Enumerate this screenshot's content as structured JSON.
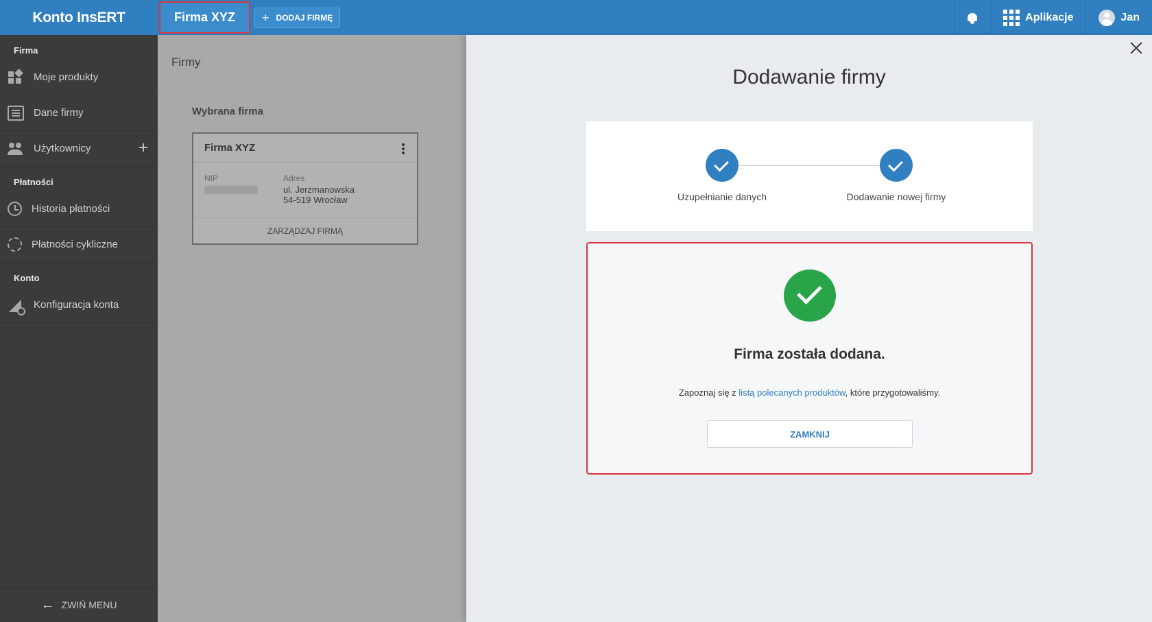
{
  "topbar": {
    "brand": "Konto InsERT",
    "active_firm": "Firma XYZ",
    "add_firm_label": "DODAJ FIRMĘ",
    "apps_label": "Aplikacje",
    "user_name": "Jan"
  },
  "sidebar": {
    "sections": {
      "firma": "Firma",
      "platnosci": "Płatności",
      "konto": "Konto"
    },
    "items": {
      "moje_produkty": "Moje produkty",
      "dane_firmy": "Dane firmy",
      "uzytkownicy": "Użytkownicy",
      "historia_platnosci": "Historia płatności",
      "platnosci_cykliczne": "Płatności cykliczne",
      "konfiguracja_konta": "Konfiguracja konta"
    },
    "collapse_label": "ZWIŃ MENU"
  },
  "firms_page": {
    "title": "Firmy",
    "selected_label": "Wybrana firma",
    "card": {
      "name": "Firma XYZ",
      "nip_label": "NIP",
      "address_label": "Adres",
      "address_line1": "ul. Jerzmanowska",
      "address_line2": "54-519 Wrocław",
      "manage_label": "ZARZĄDZAJ FIRMĄ"
    }
  },
  "panel": {
    "title": "Dodawanie firmy",
    "steps": [
      {
        "label": "Uzupełnianie danych"
      },
      {
        "label": "Dodawanie nowej firmy"
      }
    ],
    "success": {
      "title": "Firma została dodana.",
      "text_before": "Zapoznaj się z ",
      "link_text": "listą polecanych produktów",
      "text_after": ", które przygotowaliśmy.",
      "close_label": "ZAMKNIJ"
    }
  },
  "colors": {
    "primary": "#2f7fc1",
    "success": "#2aa448",
    "highlight": "#d9363e",
    "sidebar": "#3b3b3b"
  }
}
